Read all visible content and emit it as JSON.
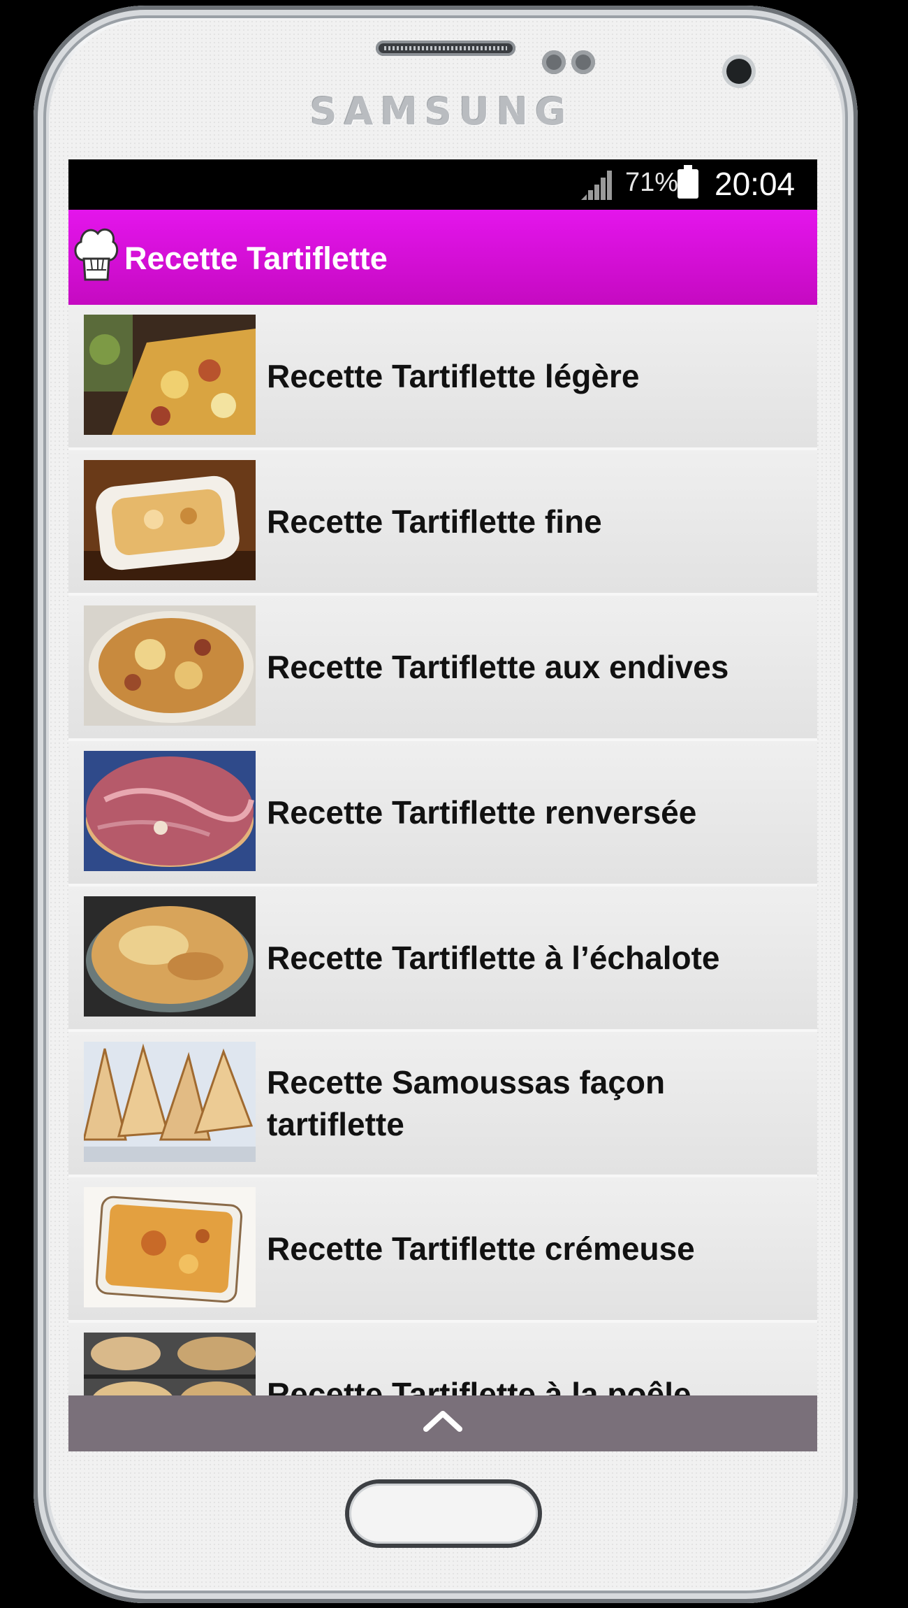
{
  "device": {
    "brand": "SAMSUNG"
  },
  "statusbar": {
    "battery": "71%",
    "time": "20:04"
  },
  "appbar": {
    "icon": "chef-hat-icon",
    "title": "Recette Tartiflette",
    "color": "#e415ec"
  },
  "recipes": [
    {
      "title": "Recette Tartiflette légère"
    },
    {
      "title": "Recette Tartiflette fine"
    },
    {
      "title": "Recette Tartiflette aux endives"
    },
    {
      "title": "Recette Tartiflette renversée"
    },
    {
      "title": "Recette Tartiflette à l’échalote"
    },
    {
      "title": "Recette Samoussas façon tartiflette"
    },
    {
      "title": "Recette Tartiflette crémeuse"
    },
    {
      "title": "Recette Tartiflette à la poêle"
    }
  ],
  "bottom_bar": {
    "icon": "chevron-up-icon",
    "color": "#7a707a"
  }
}
